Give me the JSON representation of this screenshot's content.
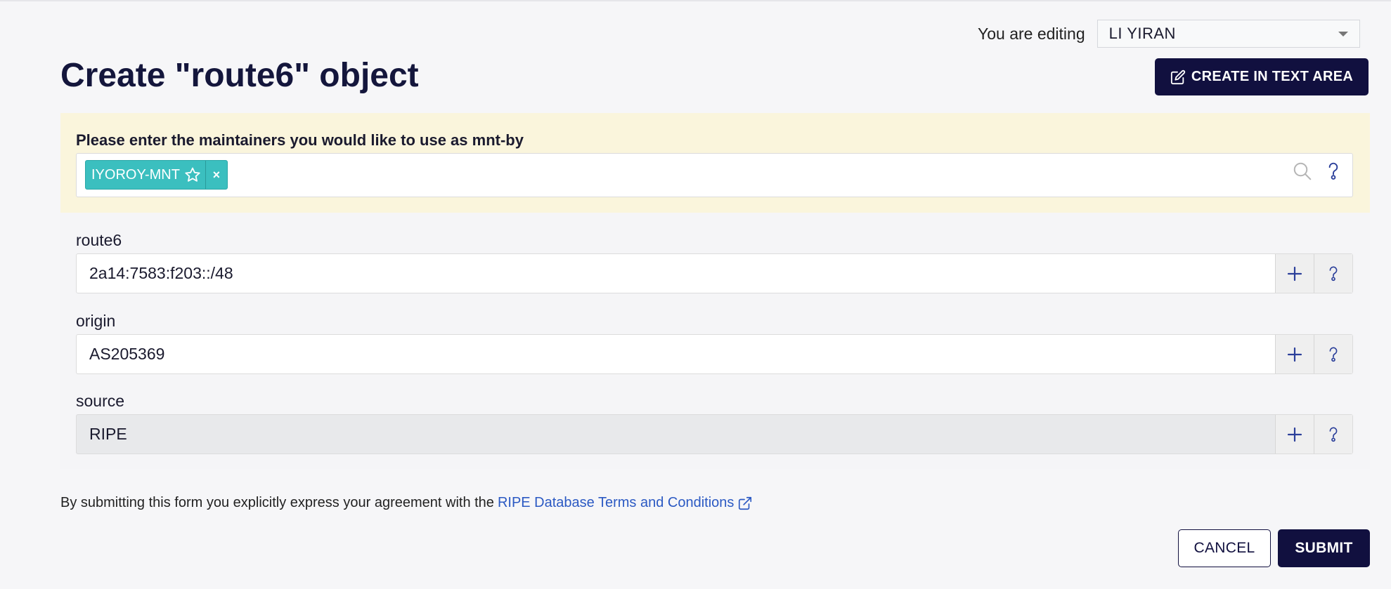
{
  "editing": {
    "label": "You are editing",
    "value": "LI YIRAN"
  },
  "page": {
    "title": "Create \"route6\" object",
    "create_text_area_label": "CREATE IN TEXT AREA"
  },
  "maintainers": {
    "label": "Please enter the maintainers you would like to use as mnt-by",
    "selected": [
      {
        "name": "IYOROY-MNT",
        "remove_label": "×"
      }
    ]
  },
  "fields": [
    {
      "label": "route6",
      "value": "2a14:7583:f203::/48",
      "readonly": false
    },
    {
      "label": "origin",
      "value": "AS205369",
      "readonly": false
    },
    {
      "label": "source",
      "value": "RIPE",
      "readonly": true
    }
  ],
  "terms": {
    "text": "By submitting this form you explicitly express your agreement with the",
    "link_text": "RIPE Database Terms and Conditions"
  },
  "actions": {
    "cancel_label": "CANCEL",
    "submit_label": "SUBMIT"
  },
  "colors": {
    "primary": "#11103f",
    "tag": "#3bbfbf",
    "link": "#2b59c3",
    "maintainer_panel": "#faf5dc"
  },
  "icons": [
    "caret-down-icon",
    "edit-icon",
    "star-icon",
    "search-icon",
    "help-icon",
    "plus-icon",
    "external-link-icon"
  ]
}
